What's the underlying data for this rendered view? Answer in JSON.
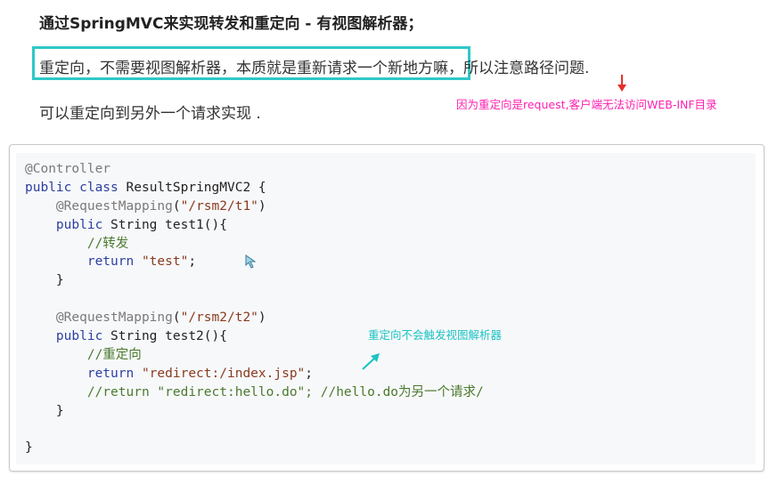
{
  "heading": "通过SpringMVC来实现转发和重定向 - 有视图解析器；",
  "line1": "重定向，不需要视图解析器，本质就是重新请求一个新地方嘛，所以注意路径问题.",
  "line2": "可以重定向到另外一个请求实现 .",
  "annotations": {
    "red_note": "因为重定向是request,客户端无法访问WEB-INF目录",
    "teal_note": "重定向不会触发视图解析器"
  },
  "code": {
    "lines": [
      [
        {
          "t": "ann",
          "v": "@Controller"
        }
      ],
      [
        {
          "t": "kw",
          "v": "public class "
        },
        {
          "t": "plain",
          "v": "ResultSpringMVC2 {"
        }
      ],
      [
        {
          "t": "plain",
          "v": "    "
        },
        {
          "t": "ann",
          "v": "@RequestMapping"
        },
        {
          "t": "plain",
          "v": "("
        },
        {
          "t": "str",
          "v": "\"/rsm2/t1\""
        },
        {
          "t": "plain",
          "v": ")"
        }
      ],
      [
        {
          "t": "plain",
          "v": "    "
        },
        {
          "t": "kw",
          "v": "public "
        },
        {
          "t": "plain",
          "v": "String test1(){"
        }
      ],
      [
        {
          "t": "plain",
          "v": "        "
        },
        {
          "t": "cm",
          "v": "//转发"
        }
      ],
      [
        {
          "t": "plain",
          "v": "        "
        },
        {
          "t": "kw",
          "v": "return "
        },
        {
          "t": "str",
          "v": "\"test\""
        },
        {
          "t": "plain",
          "v": ";"
        }
      ],
      [
        {
          "t": "plain",
          "v": "    }"
        }
      ],
      [
        {
          "t": "plain",
          "v": ""
        }
      ],
      [
        {
          "t": "plain",
          "v": "    "
        },
        {
          "t": "ann",
          "v": "@RequestMapping"
        },
        {
          "t": "plain",
          "v": "("
        },
        {
          "t": "str",
          "v": "\"/rsm2/t2\""
        },
        {
          "t": "plain",
          "v": ")"
        }
      ],
      [
        {
          "t": "plain",
          "v": "    "
        },
        {
          "t": "kw",
          "v": "public "
        },
        {
          "t": "plain",
          "v": "String test2(){"
        }
      ],
      [
        {
          "t": "plain",
          "v": "        "
        },
        {
          "t": "cm",
          "v": "//重定向"
        }
      ],
      [
        {
          "t": "plain",
          "v": "        "
        },
        {
          "t": "kw",
          "v": "return "
        },
        {
          "t": "str",
          "v": "\"redirect:/index.jsp\""
        },
        {
          "t": "plain",
          "v": ";"
        }
      ],
      [
        {
          "t": "plain",
          "v": "        "
        },
        {
          "t": "cm",
          "v": "//return \"redirect:hello.do\"; //hello.do为另一个请求/"
        }
      ],
      [
        {
          "t": "plain",
          "v": "    }"
        }
      ],
      [
        {
          "t": "plain",
          "v": ""
        }
      ],
      [
        {
          "t": "plain",
          "v": "}"
        }
      ]
    ]
  },
  "colors": {
    "highlight_box": "#2ec8c8",
    "red_note": "#ff1fb0",
    "red_arrow": "#e8302a",
    "teal_note": "#1ec3c3"
  },
  "icons": [
    "red-down-arrow-icon",
    "teal-up-arrow-icon",
    "mouse-cursor-icon"
  ]
}
